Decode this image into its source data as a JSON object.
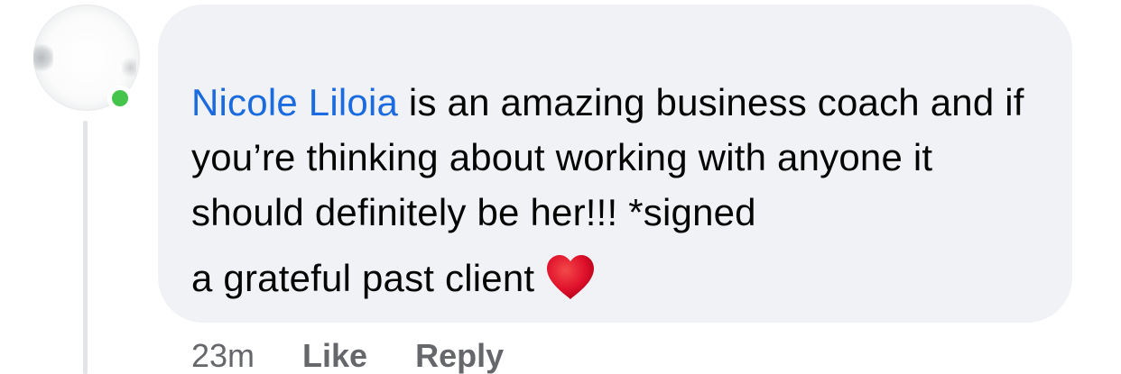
{
  "comment": {
    "author": "Nicole Liloia",
    "text_part1": " is an amazing business coach and if you’re thinking about working with anyone it should definitely be her!!! *signed",
    "text_part2": "a grateful past client",
    "reaction_icon": "heart-icon",
    "heart_color": "#e0112b",
    "link_color": "#1b6be0",
    "presence_status": "online",
    "presence_color": "#44c44b"
  },
  "meta": {
    "time": "23m",
    "like_label": "Like",
    "reply_label": "Reply"
  }
}
